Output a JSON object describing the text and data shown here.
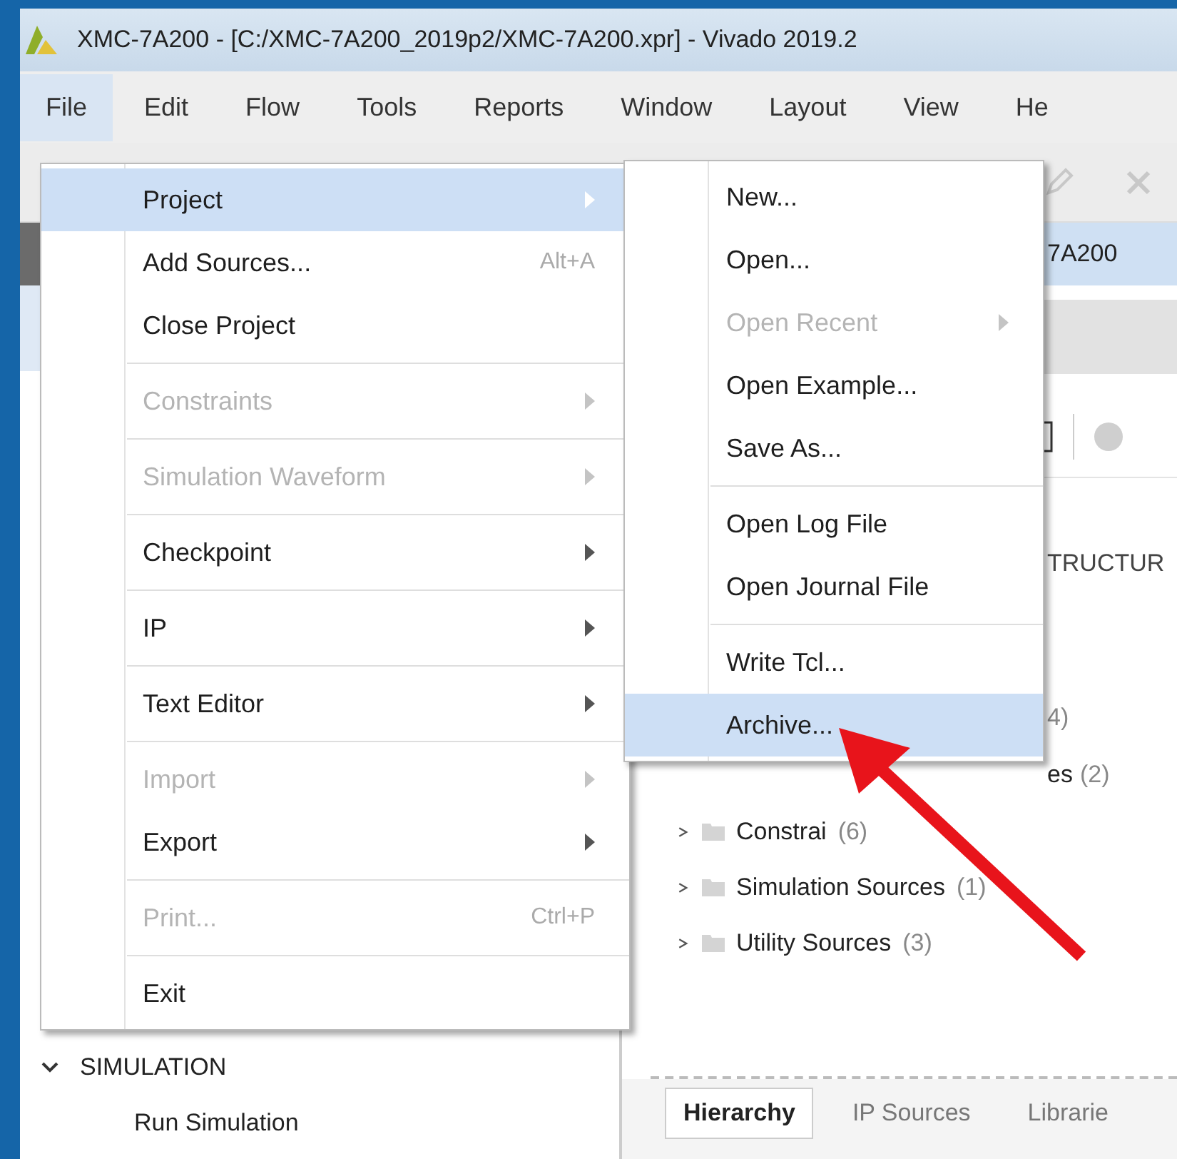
{
  "window": {
    "title": "XMC-7A200 - [C:/XMC-7A200_2019p2/XMC-7A200.xpr] - Vivado 2019.2"
  },
  "menu_bar": [
    {
      "label": "File",
      "selected": true
    },
    {
      "label": "Edit",
      "selected": false
    },
    {
      "label": "Flow",
      "selected": false
    },
    {
      "label": "Tools",
      "selected": false
    },
    {
      "label": "Reports",
      "selected": false
    },
    {
      "label": "Window",
      "selected": false
    },
    {
      "label": "Layout",
      "selected": false
    },
    {
      "label": "View",
      "selected": false
    },
    {
      "label": "He",
      "selected": false
    }
  ],
  "file_menu": [
    {
      "kind": "item",
      "label": "Project",
      "submenu": true,
      "disabled": false,
      "selected": true
    },
    {
      "kind": "item",
      "label": "Add Sources...",
      "shortcut": "Alt+A",
      "submenu": false,
      "disabled": false,
      "selected": false
    },
    {
      "kind": "item",
      "label": "Close Project",
      "submenu": false,
      "disabled": false,
      "selected": false
    },
    {
      "kind": "separator"
    },
    {
      "kind": "item",
      "label": "Constraints",
      "submenu": true,
      "disabled": true,
      "selected": false
    },
    {
      "kind": "separator"
    },
    {
      "kind": "item",
      "label": "Simulation Waveform",
      "submenu": true,
      "disabled": true,
      "selected": false
    },
    {
      "kind": "separator"
    },
    {
      "kind": "item",
      "label": "Checkpoint",
      "submenu": true,
      "disabled": false,
      "selected": false
    },
    {
      "kind": "separator"
    },
    {
      "kind": "item",
      "label": "IP",
      "submenu": true,
      "disabled": false,
      "selected": false
    },
    {
      "kind": "separator"
    },
    {
      "kind": "item",
      "label": "Text Editor",
      "submenu": true,
      "disabled": false,
      "selected": false
    },
    {
      "kind": "separator"
    },
    {
      "kind": "item",
      "label": "Import",
      "submenu": true,
      "disabled": true,
      "selected": false
    },
    {
      "kind": "item",
      "label": "Export",
      "submenu": true,
      "disabled": false,
      "selected": false
    },
    {
      "kind": "separator"
    },
    {
      "kind": "item",
      "label": "Print...",
      "shortcut": "Ctrl+P",
      "submenu": false,
      "disabled": true,
      "selected": false
    },
    {
      "kind": "separator"
    },
    {
      "kind": "item",
      "label": "Exit",
      "submenu": false,
      "disabled": false,
      "selected": false
    }
  ],
  "project_submenu": [
    {
      "kind": "item",
      "label": "New...",
      "submenu": false,
      "disabled": false,
      "selected": false
    },
    {
      "kind": "item",
      "label": "Open...",
      "submenu": false,
      "disabled": false,
      "selected": false
    },
    {
      "kind": "item",
      "label": "Open Recent",
      "submenu": true,
      "disabled": true,
      "selected": false
    },
    {
      "kind": "item",
      "label": "Open Example...",
      "submenu": false,
      "disabled": false,
      "selected": false
    },
    {
      "kind": "item",
      "label": "Save As...",
      "submenu": false,
      "disabled": false,
      "selected": false
    },
    {
      "kind": "separator"
    },
    {
      "kind": "item",
      "label": "Open Log File",
      "submenu": false,
      "disabled": false,
      "selected": false
    },
    {
      "kind": "item",
      "label": "Open Journal File",
      "submenu": false,
      "disabled": false,
      "selected": false
    },
    {
      "kind": "separator"
    },
    {
      "kind": "item",
      "label": "Write Tcl...",
      "submenu": false,
      "disabled": false,
      "selected": false
    },
    {
      "kind": "item",
      "label": "Archive...",
      "submenu": false,
      "disabled": false,
      "selected": true
    }
  ],
  "project_header": "7A200",
  "section_label": "TRUCTUR",
  "partial_rows": [
    {
      "name": "",
      "count": "4)"
    },
    {
      "name": "es",
      "count": "(2)"
    }
  ],
  "source_tree": [
    {
      "name": "Constrai",
      "count": "(6)",
      "expanded": false
    },
    {
      "name": "Simulation Sources",
      "count": "(1)",
      "expanded": false
    },
    {
      "name": "Utility Sources",
      "count": "(3)",
      "expanded": false
    }
  ],
  "sources_tabs": [
    {
      "label": "Hierarchy",
      "selected": true
    },
    {
      "label": "IP Sources",
      "selected": false
    },
    {
      "label": "Librarie",
      "selected": false
    }
  ],
  "flow_navigator": {
    "section": "SIMULATION",
    "expanded": true,
    "items": [
      "Run Simulation"
    ]
  }
}
